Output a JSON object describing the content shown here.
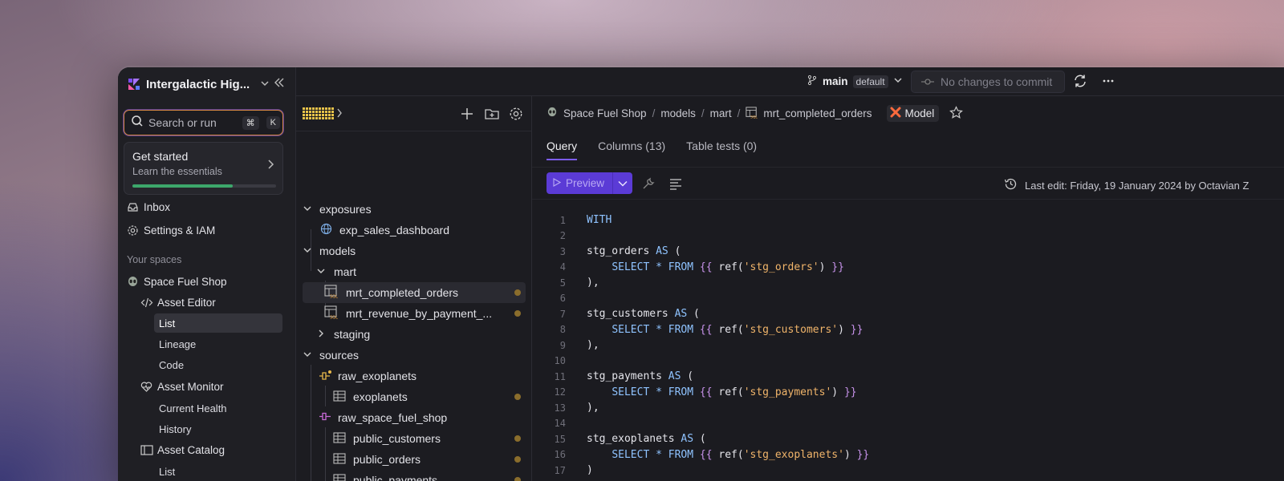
{
  "org": {
    "name": "Intergalactic Hig..."
  },
  "search": {
    "placeholder": "Search or run",
    "shortcut_cmd": "⌘",
    "shortcut_key": "K"
  },
  "get_started": {
    "title": "Get started",
    "subtitle": "Learn the essentials",
    "progress": 0.7
  },
  "nav": {
    "inbox": "Inbox",
    "settings": "Settings & IAM"
  },
  "spaces_label": "Your spaces",
  "space": {
    "name": "Space Fuel Shop",
    "asset_editor": {
      "label": "Asset Editor",
      "items": [
        "List",
        "Lineage",
        "Code"
      ]
    },
    "asset_monitor": {
      "label": "Asset Monitor",
      "items": [
        "Current Health",
        "History"
      ]
    },
    "asset_catalog": {
      "label": "Asset Catalog",
      "items": [
        "List"
      ]
    }
  },
  "topbar": {
    "branch": "main",
    "branch_tag": "default",
    "commit": "No changes to commit"
  },
  "tree": {
    "exposures": "exposures",
    "exp_sales_dashboard": "exp_sales_dashboard",
    "models": "models",
    "mart": "mart",
    "mrt_completed_orders": "mrt_completed_orders",
    "mrt_revenue": "mrt_revenue_by_payment_...",
    "staging": "staging",
    "sources": "sources",
    "raw_exoplanets": "raw_exoplanets",
    "exoplanets": "exoplanets",
    "raw_space_fuel_shop": "raw_space_fuel_shop",
    "public_customers": "public_customers",
    "public_orders": "public_orders",
    "public_payments": "public_payments"
  },
  "breadcrumb": [
    "Space Fuel Shop",
    "models",
    "mart",
    "mrt_completed_orders"
  ],
  "model_badge": "Model",
  "tabs": [
    "Query",
    "Columns (13)",
    "Table tests (0)"
  ],
  "toolbar": {
    "preview": "Preview",
    "last_edit": "Last edit: Friday, 19 January 2024 by Octavian Z"
  },
  "code": [
    {
      "n": "1",
      "t": "WITH"
    },
    {
      "n": "2",
      "t": ""
    },
    {
      "n": "3",
      "t": "stg_orders AS ("
    },
    {
      "n": "4",
      "t": "    SELECT * FROM {{ ref('stg_orders') }}"
    },
    {
      "n": "5",
      "t": "),"
    },
    {
      "n": "6",
      "t": ""
    },
    {
      "n": "7",
      "t": "stg_customers AS ("
    },
    {
      "n": "8",
      "t": "    SELECT * FROM {{ ref('stg_customers') }}"
    },
    {
      "n": "9",
      "t": "),"
    },
    {
      "n": "10",
      "t": ""
    },
    {
      "n": "11",
      "t": "stg_payments AS ("
    },
    {
      "n": "12",
      "t": "    SELECT * FROM {{ ref('stg_payments') }}"
    },
    {
      "n": "13",
      "t": "),"
    },
    {
      "n": "14",
      "t": ""
    },
    {
      "n": "15",
      "t": "stg_exoplanets AS ("
    },
    {
      "n": "16",
      "t": "    SELECT * FROM {{ ref('stg_exoplanets') }}"
    },
    {
      "n": "17",
      "t": ")"
    }
  ],
  "colors": {
    "accent": "#5b3bd6",
    "progress": "#3da76b",
    "status_dot": "#8a6d2c"
  }
}
